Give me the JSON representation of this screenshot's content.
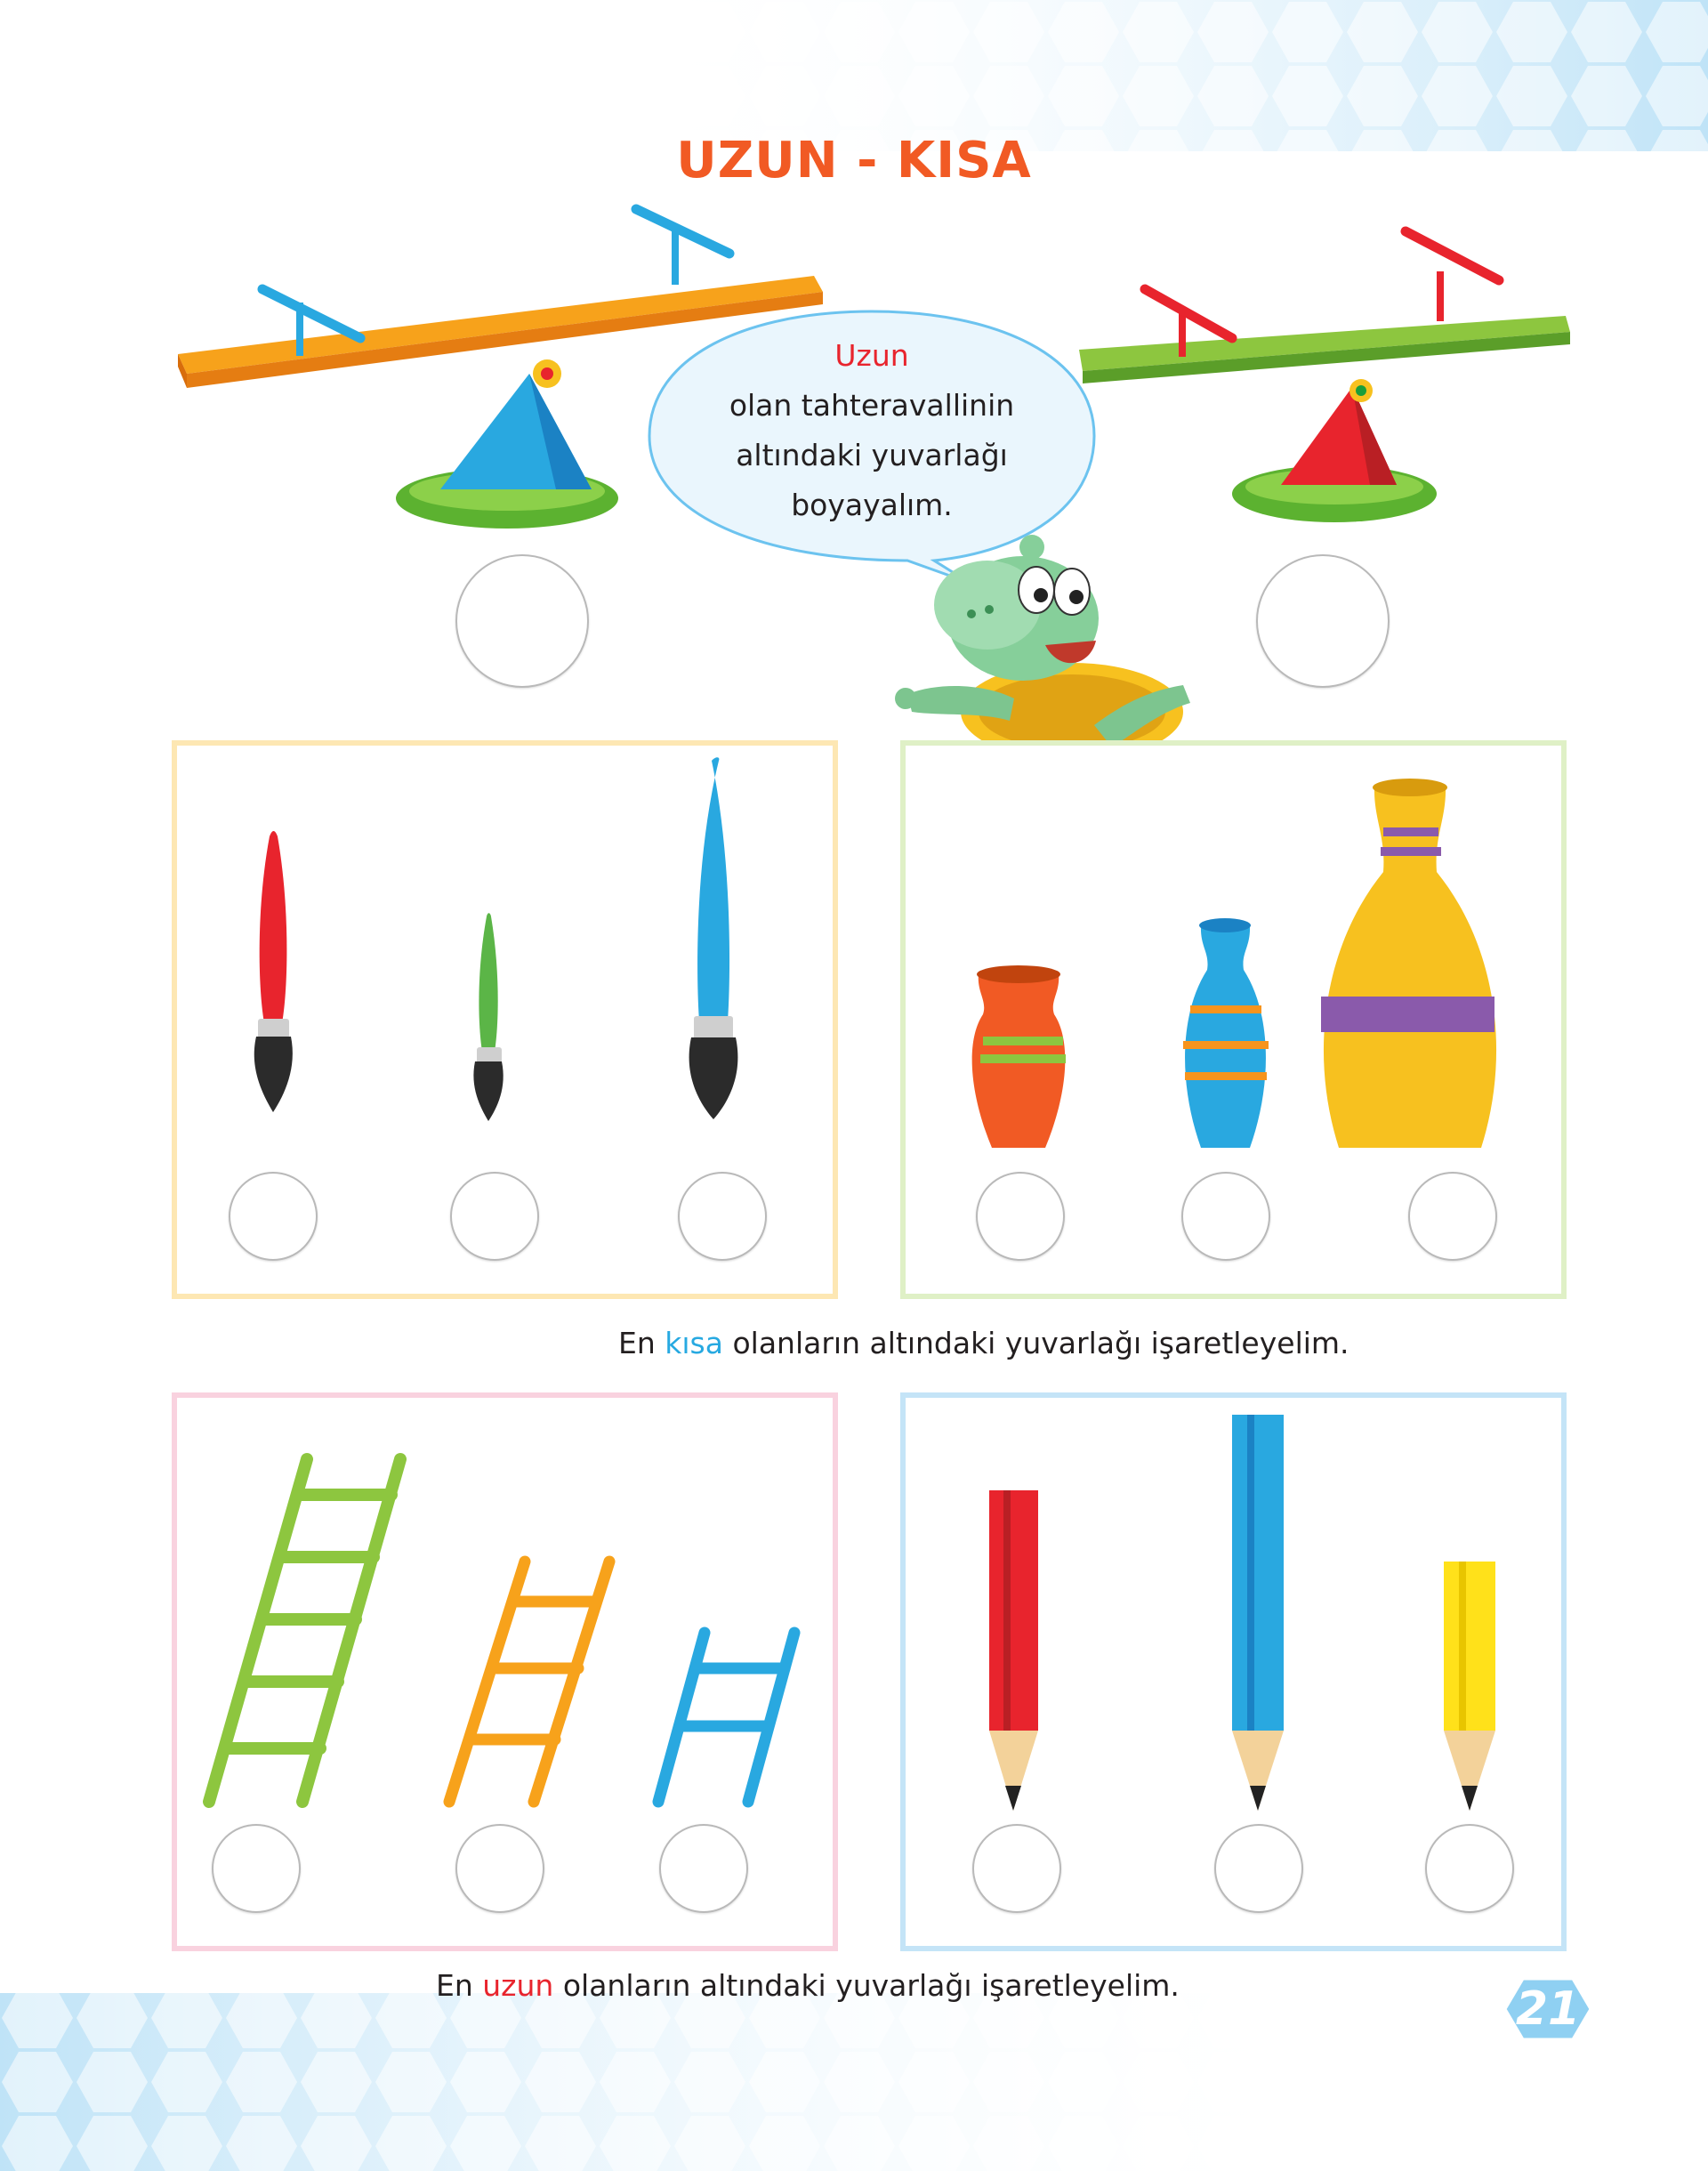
{
  "title": "UZUN - KISA",
  "speech_bubble": {
    "highlight": "Uzun",
    "line1": "olan tahteravallinin",
    "line2": "altındaki yuvarlağı",
    "line3": "boyayalım."
  },
  "instruction_short": {
    "pre": "En ",
    "highlight": "kısa",
    "post": " olanların altındaki yuvarlağı işaretleyelim."
  },
  "instruction_long": {
    "pre": "En ",
    "highlight": "uzun",
    "post": " olanların altındaki yuvarlağı işaretleyelim."
  },
  "page_number": "21",
  "colors": {
    "title": "#f15a24",
    "highlight_red": "#e8242d",
    "highlight_blue": "#27a9e1",
    "panel_yellow": "#fde7b3",
    "panel_green": "#dff0c6",
    "panel_pink": "#f9d2df",
    "panel_blue": "#c4e4f7"
  }
}
